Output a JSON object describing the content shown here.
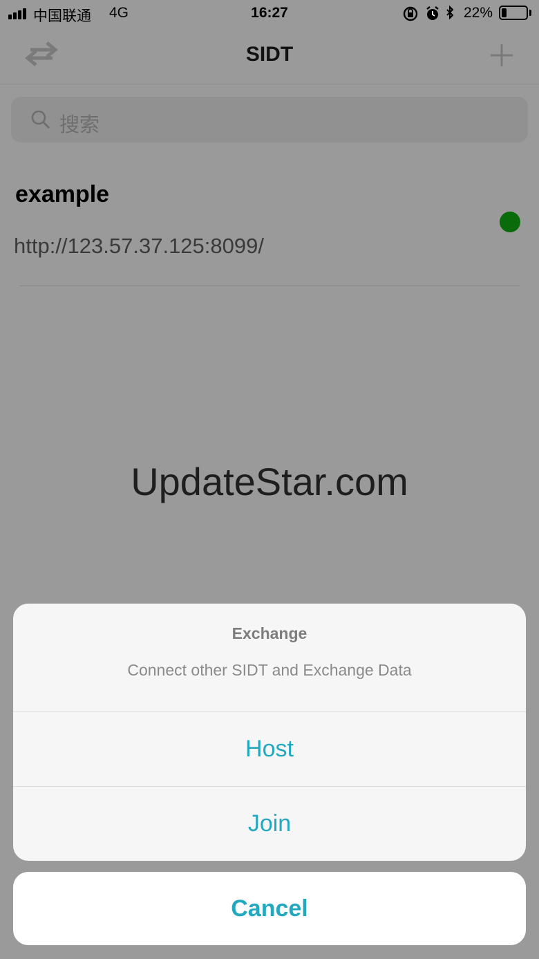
{
  "status_bar": {
    "carrier": "中国联通",
    "network": "4G",
    "time": "16:27",
    "battery_percent": "22%",
    "battery_level": 0.22,
    "icons": [
      "orientation-lock-icon",
      "alarm-icon",
      "bluetooth-icon"
    ]
  },
  "nav": {
    "title": "SIDT",
    "left_icon": "exchange-arrows-icon",
    "right_icon": "plus-icon"
  },
  "search": {
    "placeholder": "搜索"
  },
  "list": {
    "items": [
      {
        "title": "example",
        "url": "http://123.57.37.125:8099/",
        "status_color": "#0a6b0a"
      }
    ]
  },
  "watermark": "UpdateStar.com",
  "action_sheet": {
    "title": "Exchange",
    "message": "Connect other SIDT and Exchange Data",
    "actions": [
      "Host",
      "Join"
    ],
    "cancel_label": "Cancel",
    "accent_color": "#22a9c0"
  }
}
